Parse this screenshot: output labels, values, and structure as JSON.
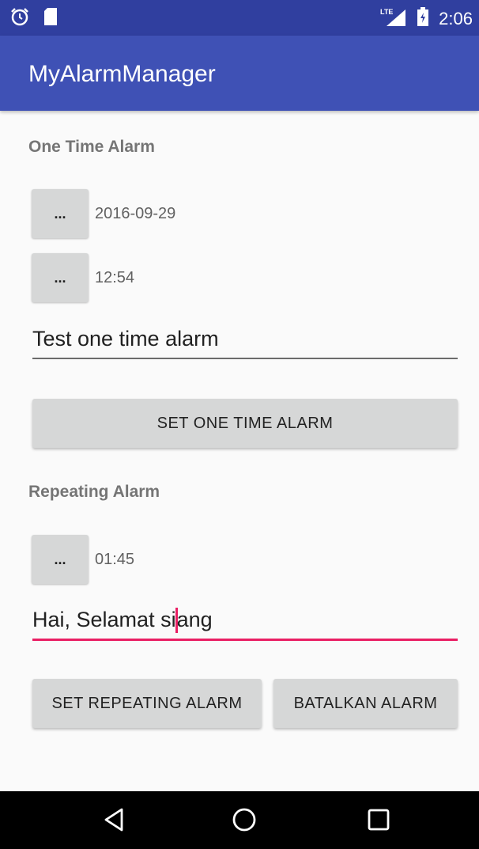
{
  "status_bar": {
    "time": "2:06",
    "network": "LTE",
    "left_icons": [
      "alarm-icon",
      "sd-card-icon"
    ],
    "right_icons": [
      "signal-lte-icon",
      "battery-icon"
    ]
  },
  "app_bar": {
    "title": "MyAlarmManager"
  },
  "one_time": {
    "section_title": "One Time Alarm",
    "date_button_label": "...",
    "date_value": "2016-09-29",
    "time_button_label": "...",
    "time_value": "12:54",
    "message_value": "Test one time alarm",
    "set_button_label": "SET ONE TIME ALARM"
  },
  "repeating": {
    "section_title": "Repeating Alarm",
    "time_button_label": "...",
    "time_value": "01:45",
    "message_before_cursor": "Hai, Selamat si",
    "message_after_cursor": "ang",
    "set_button_label": "SET REPEATING ALARM",
    "cancel_button_label": "BATALKAN ALARM"
  },
  "nav_bar": {
    "icons": [
      "back-icon",
      "home-icon",
      "recents-icon"
    ]
  },
  "colors": {
    "primary": "#3f51b5",
    "primary_dark": "#303f9f",
    "accent": "#e91e63",
    "button_bg": "#d6d7d7"
  }
}
